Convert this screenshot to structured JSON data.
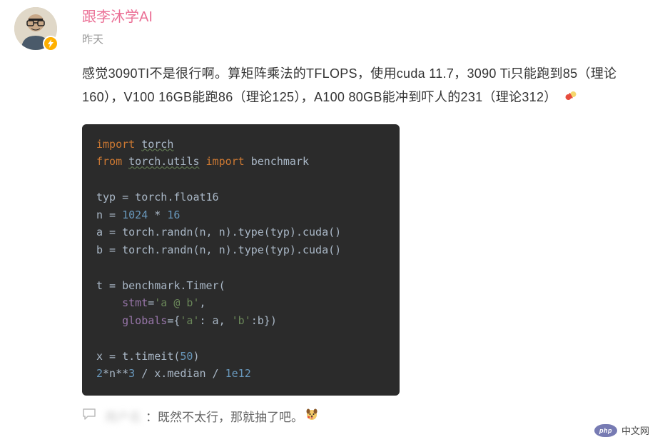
{
  "post": {
    "author": "跟李沐学AI",
    "time": "昨天",
    "body": "感觉3090TI不是很行啊。算矩阵乘法的TFLOPS，使用cuda 11.7，3090 Ti只能跑到85（理论160），V100 16GB能跑86（理论125），A100 80GB能冲到吓人的231（理论312）",
    "code": {
      "l1a": "import",
      "l1b": "torch",
      "l2a": "from",
      "l2b": "torch.utils",
      "l2c": "import",
      "l2d": "benchmark",
      "l3a": "typ = torch.float16",
      "l4a": "n = ",
      "l4n": "1024",
      "l4b": " * ",
      "l4n2": "16",
      "l5a": "a = torch.randn(n, n).type(typ).cuda()",
      "l6a": "b = torch.randn(n, n).type(typ).cuda()",
      "l7a": "t = benchmark.Timer(",
      "l8a": "    ",
      "l8b": "stmt",
      "l8c": "=",
      "l8d": "'a @ b'",
      "l8e": ",",
      "l9a": "    ",
      "l9b": "globals",
      "l9c": "={",
      "l9d": "'a'",
      "l9e": ": a, ",
      "l9f": "'b'",
      "l9g": ":b})",
      "l10a": "x = t.timeit(",
      "l10n": "50",
      "l10b": ")",
      "l11n1": "2",
      "l11a": "*n**",
      "l11n2": "3",
      "l11b": " / x.median / ",
      "l11n3": "1e12"
    }
  },
  "comment": {
    "commenter": "用户名",
    "separator": "：",
    "text": "既然不太行，那就抽了吧。"
  },
  "watermark": {
    "logo": "php",
    "text": "中文网"
  }
}
